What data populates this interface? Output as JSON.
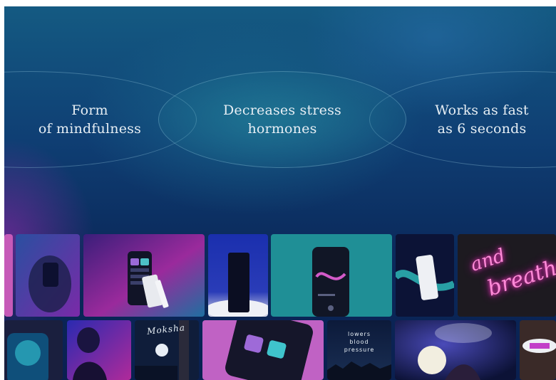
{
  "features": [
    {
      "line1": "Form",
      "line2": "of mindfulness"
    },
    {
      "line1": "Decreases stress",
      "line2": "hormones"
    },
    {
      "line1": "Works as fast",
      "line2": "as 6 seconds"
    }
  ],
  "gallery": {
    "neon_line1": "and",
    "neon_line2": "breathe",
    "moksha_label": "Moksha",
    "pressure_caption_1": "lowers",
    "pressure_caption_2": "blood",
    "pressure_caption_3": "pressure"
  },
  "colors": {
    "background_top": "#145a82",
    "background_bottom": "#0a2050",
    "accent_teal": "#1f9aa0",
    "accent_magenta": "#c23fc8",
    "text": "#e6eef4"
  }
}
